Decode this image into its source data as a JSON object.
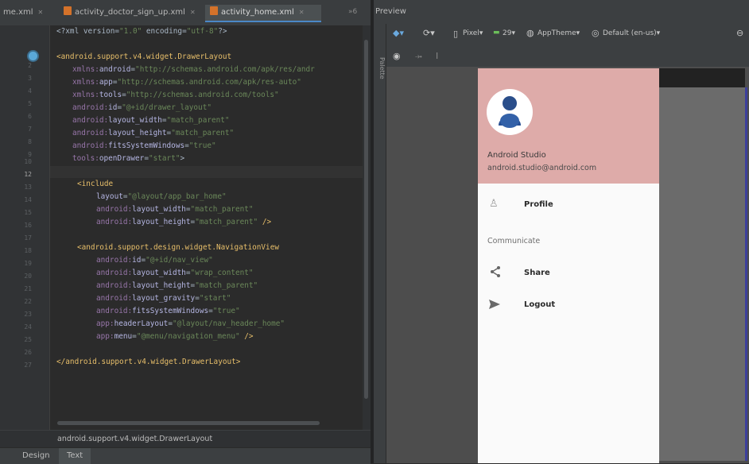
{
  "tabs": [
    {
      "label": "me.xml",
      "active": false
    },
    {
      "label": "activity_doctor_sign_up.xml",
      "active": false
    },
    {
      "label": "activity_home.xml",
      "active": true
    }
  ],
  "tab_overflow": "»6",
  "line_numbers": [
    "2",
    "3",
    "4",
    "5",
    "6",
    "7",
    "8",
    "9",
    "10",
    "11",
    "12",
    "13",
    "14",
    "15",
    "16",
    "17",
    "18",
    "19",
    "20",
    "21",
    "22",
    "23",
    "24",
    "25",
    "26",
    "27"
  ],
  "current_line": "12",
  "code": {
    "l1_a": "<?xml version=",
    "l1_b": "\"1.0\"",
    "l1_c": " encoding=",
    "l1_d": "\"utf-8\"",
    "l1_e": "?>",
    "l3_tag": "<android.support.v4.widget.DrawerLayout",
    "l4_ns": "xmlns:",
    "l4_attr": "android",
    "l4_eq": "=",
    "l4_val": "\"http://schemas.android.com/apk/res/andr",
    "l5_ns": "xmlns:",
    "l5_attr": "app",
    "l5_eq": "=",
    "l5_val": "\"http://schemas.android.com/apk/res-auto\"",
    "l6_ns": "xmlns:",
    "l6_attr": "tools",
    "l6_eq": "=",
    "l6_val": "\"http://schemas.android.com/tools\"",
    "l7_ns": "android:",
    "l7_attr": "id",
    "l7_eq": "=",
    "l7_val": "\"@+id/drawer_layout\"",
    "l8_ns": "android:",
    "l8_attr": "layout_width",
    "l8_eq": "=",
    "l8_val": "\"match_parent\"",
    "l9_ns": "android:",
    "l9_attr": "layout_height",
    "l9_eq": "=",
    "l9_val": "\"match_parent\"",
    "l10_ns": "android:",
    "l10_attr": "fitsSystemWindows",
    "l10_eq": "=",
    "l10_val": "\"true\"",
    "l11_ns": "tools:",
    "l11_attr": "openDrawer",
    "l11_eq": "=",
    "l11_val": "\"start\"",
    "l11_end": ">",
    "l13_tag": "<include",
    "l14_attr": "layout",
    "l14_eq": "=",
    "l14_val": "\"@layout/app_bar_home\"",
    "l15_ns": "android:",
    "l15_attr": "layout_width",
    "l15_eq": "=",
    "l15_val": "\"match_parent\"",
    "l16_ns": "android:",
    "l16_attr": "layout_height",
    "l16_eq": "=",
    "l16_val": "\"match_parent\"",
    "l16_end": " />",
    "l18_tag": "<android.support.design.widget.NavigationView",
    "l19_ns": "android:",
    "l19_attr": "id",
    "l19_eq": "=",
    "l19_val": "\"@+id/nav_view\"",
    "l20_ns": "android:",
    "l20_attr": "layout_width",
    "l20_eq": "=",
    "l20_val": "\"wrap_content\"",
    "l21_ns": "android:",
    "l21_attr": "layout_height",
    "l21_eq": "=",
    "l21_val": "\"match_parent\"",
    "l22_ns": "android:",
    "l22_attr": "layout_gravity",
    "l22_eq": "=",
    "l22_val": "\"start\"",
    "l23_ns": "android:",
    "l23_attr": "fitsSystemWindows",
    "l23_eq": "=",
    "l23_val": "\"true\"",
    "l24_ns": "app:",
    "l24_attr": "headerLayout",
    "l24_eq": "=",
    "l24_val": "\"@layout/nav_header_home\"",
    "l25_ns": "app:",
    "l25_attr": "menu",
    "l25_eq": "=",
    "l25_val": "\"@menu/navigation_menu\"",
    "l25_end": " />",
    "l27_tag": "</android.support.v4.widget.DrawerLayout>"
  },
  "breadcrumb": "android.support.v4.widget.DrawerLayout",
  "bottom_tabs": {
    "design": "Design",
    "text": "Text"
  },
  "preview": {
    "title": "Preview",
    "palette_label": "Palette",
    "device": "Pixel",
    "api": "29",
    "theme": "AppTheme",
    "locale": "Default (en-us)"
  },
  "drawer": {
    "name": "Android Studio",
    "email": "android.studio@android.com",
    "items": [
      {
        "label": "Profile",
        "icon": "person-icon"
      },
      {
        "label": "Share",
        "icon": "share-icon"
      },
      {
        "label": "Logout",
        "icon": "send-icon"
      }
    ],
    "group_title": "Communicate"
  },
  "colors": {
    "header_pink": "#deaba9",
    "editor_bg": "#2b2b2b",
    "xml_tag": "#e8bf6a",
    "xml_string": "#6a8759"
  }
}
